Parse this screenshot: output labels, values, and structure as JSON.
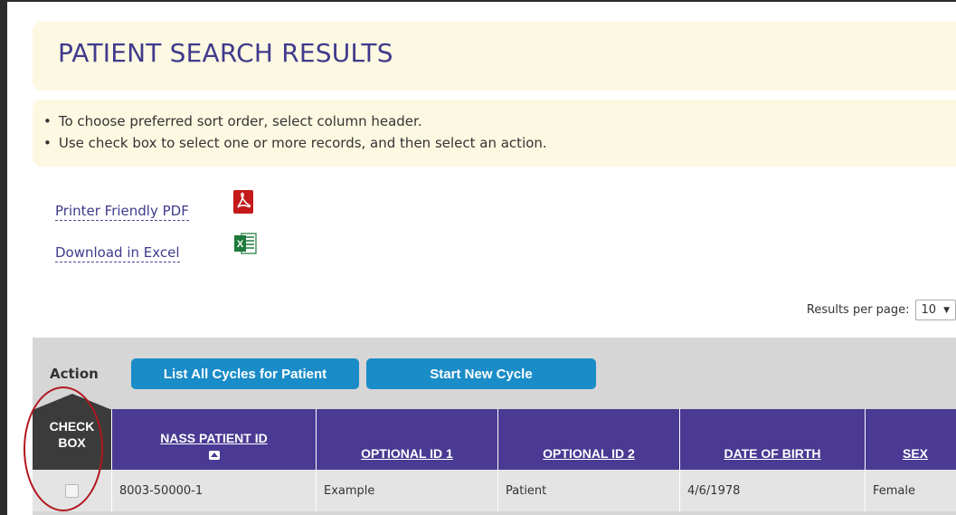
{
  "title": "PATIENT SEARCH RESULTS",
  "instructions": [
    "To choose preferred sort order, select column header.",
    "Use check box to select one or more records, and then select an action."
  ],
  "downloads": {
    "pdf_label": "Printer Friendly PDF",
    "excel_label": "Download in Excel"
  },
  "results_per_page": {
    "label": "Results per page:",
    "value": "10"
  },
  "actions": {
    "label": "Action",
    "list_all": "List All Cycles for Patient",
    "start_new": "Start New Cycle"
  },
  "table": {
    "columns": {
      "check_line1": "CHECK",
      "check_line2": "BOX",
      "nass_id": "NASS PATIENT ID",
      "opt1": "OPTIONAL ID 1",
      "opt2": "OPTIONAL ID 2",
      "dob": "DATE OF BIRTH",
      "sex": "SEX"
    },
    "rows": [
      {
        "nass_id": "8003-50000-1",
        "opt1": "Example",
        "opt2": "Patient",
        "dob": "4/6/1978",
        "sex": "Female"
      }
    ]
  },
  "colors": {
    "header_purple": "#4b3a93",
    "button_blue": "#1a8cc8",
    "highlight_red": "#b2161d",
    "panel_cream": "#fdf8e1"
  }
}
